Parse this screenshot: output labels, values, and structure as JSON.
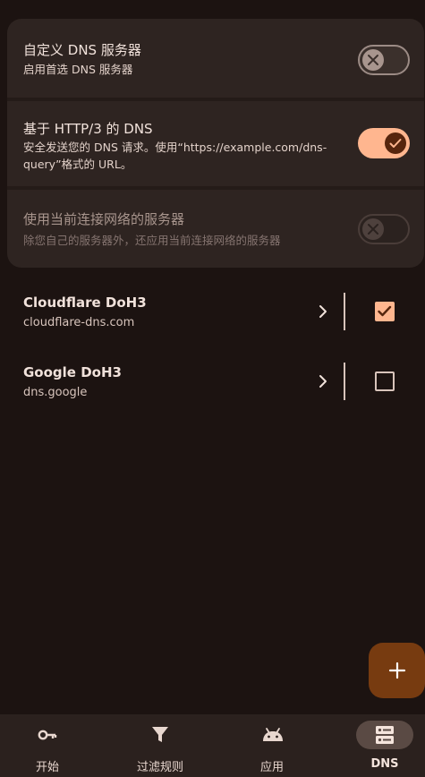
{
  "settings": {
    "custom_dns": {
      "title": "自定义 DNS 服务器",
      "description": "启用首选 DNS 服务器",
      "enabled": false
    },
    "http3": {
      "title": "基于 HTTP/3 的 DNS",
      "description": "安全发送您的 DNS 请求。使用“https://example.com/dns-query”格式的 URL。",
      "enabled": true
    },
    "use_network_dns": {
      "title": "使用当前连接网络的服务器",
      "description": "除您自己的服务器外，还应用当前连接网络的服务器",
      "enabled": false,
      "disabled": true
    }
  },
  "servers": [
    {
      "name": "Cloudflare DoH3",
      "url": "cloudflare-dns.com",
      "checked": true
    },
    {
      "name": "Google DoH3",
      "url": "dns.google",
      "checked": false
    }
  ],
  "fab": {
    "icon": "plus-icon"
  },
  "nav": {
    "items": [
      {
        "label": "开始",
        "icon": "key-icon",
        "active": false
      },
      {
        "label": "过滤规则",
        "icon": "filter-icon",
        "active": false
      },
      {
        "label": "应用",
        "icon": "android-icon",
        "active": false
      },
      {
        "label": "DNS",
        "icon": "dns-server-icon",
        "active": true
      }
    ]
  },
  "colors": {
    "background": "#1c1311",
    "accent": "#ffb68f",
    "fab": "#773b10"
  }
}
